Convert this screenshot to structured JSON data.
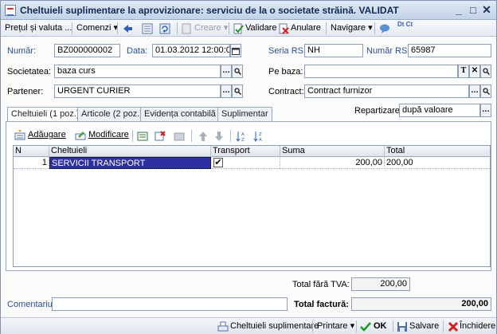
{
  "window": {
    "title": "Cheltuieli suplimentare la aprovizionare: serviciu de la o societate străină. VALIDAT",
    "minimize": "_",
    "maximize": "□",
    "close": "✕"
  },
  "toolbar": {
    "price_label": "Prețul și valuta ...",
    "commands_label": "Comenzi",
    "create_label": "Creare",
    "validate_label": "Validare",
    "cancel_label": "Anulare",
    "navigation_label": "Navigare",
    "dt_ct_label": "Dt Ct"
  },
  "form": {
    "number_label": "Număr:",
    "number_value": "BZ000000002",
    "date_label": "Data:",
    "date_value": "01.03.2012 12:00:00",
    "seria_label": "Seria RS:",
    "seria_value": "NH",
    "numar_rs_label": "Număr RS:",
    "numar_rs_value": "65987",
    "company_label": "Societatea:",
    "company_value": "baza curs",
    "pe_baza_label": "Pe baza:",
    "pe_baza_value": "",
    "partner_label": "Partener:",
    "partner_value": "URGENT CURIER",
    "contract_label": "Contract:",
    "contract_value": "Contract furnizor",
    "repartizare_label": "Repartizare:",
    "repartizare_value": "după valoare"
  },
  "tabs": [
    {
      "label": "Cheltuieli (1 poz.)"
    },
    {
      "label": "Articole (2 poz.)"
    },
    {
      "label": "Evidența contabilă"
    },
    {
      "label": "Suplimentar"
    }
  ],
  "panel_toolbar": {
    "add_label": "Adăugare",
    "modify_label": "Modificare"
  },
  "grid": {
    "columns": [
      "N",
      "Cheltuieli",
      "Transport",
      "Suma",
      "Total"
    ],
    "rows": [
      {
        "n": "1",
        "cheltuieli": "SERVICII TRANSPORT",
        "transport": "✔",
        "suma": "200,00",
        "total": "200,00"
      }
    ]
  },
  "totals": {
    "total_fara_tva_label": "Total fără TVA:",
    "total_fara_tva_value": "200,00",
    "comment_label": "Comentariu:",
    "comment_value": "",
    "total_factura_label": "Total factură:",
    "total_factura_value": "200,00"
  },
  "bottom": {
    "extra_costs_label": "Cheltuieli suplimentare",
    "print_label": "Printare",
    "ok_label": "OK",
    "save_label": "Salvare",
    "close_label": "Închidere"
  },
  "colors": {
    "accent": "#2a4f8d",
    "selection": "#2b2fa0",
    "titlebar": "#c3d2e8"
  }
}
